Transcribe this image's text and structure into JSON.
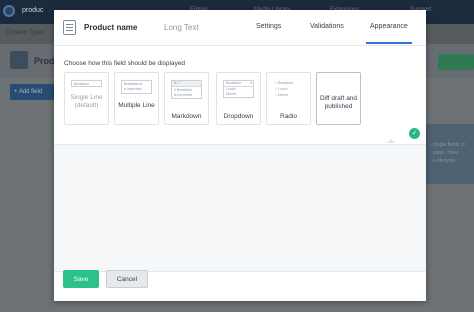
{
  "app": {
    "name": "produc",
    "nav": [
      "Entries",
      "Media Library",
      "Extensions",
      "Support"
    ],
    "breadcrumb": "Content Types",
    "content_type_name": "Produ",
    "add_field_label": "+ Add field",
    "side_note": [
      "...single fields or",
      "...ways. Have",
      "...e lifecycle"
    ]
  },
  "modal": {
    "field_name": "Product name",
    "field_type": "Long Text",
    "tabs": [
      {
        "label": "Settings",
        "active": false
      },
      {
        "label": "Validations",
        "active": false
      },
      {
        "label": "Appearance",
        "active": true
      }
    ],
    "prompt": "Choose how this field should be displayed",
    "options": [
      {
        "label": "Single Line",
        "sublabel": "(default)",
        "preview": [
          "Breakfast"
        ],
        "state": "disabled"
      },
      {
        "label": "Multiple Line",
        "preview": [
          "Breakfast is",
          "a important"
        ],
        "state": "normal"
      },
      {
        "label": "Markdown",
        "preview": [
          "B  I  \"\"",
          "# Breakfast",
          "is important"
        ],
        "state": "normal"
      },
      {
        "label": "Dropdown",
        "preview": [
          "Breakfast",
          "Lunch",
          "Dinner"
        ],
        "state": "normal"
      },
      {
        "label": "Radio",
        "preview": [
          "Breakfast",
          "Lunch",
          "Dinner"
        ],
        "state": "normal"
      },
      {
        "label": "Diff draft and published",
        "preview": [],
        "state": "selected"
      }
    ],
    "save_label": "Save",
    "cancel_label": "Cancel",
    "colors": {
      "accent": "#2e75d4",
      "primary": "#2cc18a",
      "selected_check": "#29b77f"
    }
  }
}
